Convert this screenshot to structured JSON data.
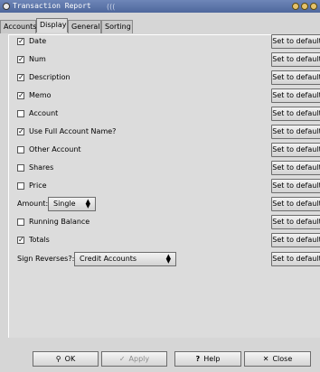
{
  "window": {
    "title": "Transaction Report",
    "title_grip": "((("
  },
  "tabs": [
    {
      "label": "Accounts",
      "active": false
    },
    {
      "label": "Display",
      "active": true
    },
    {
      "label": "General",
      "active": false
    },
    {
      "label": "Sorting",
      "active": false
    }
  ],
  "options": [
    {
      "label": "Date",
      "checked": true,
      "check_glyph": "✓"
    },
    {
      "label": "Num",
      "checked": true,
      "check_glyph": "✓"
    },
    {
      "label": "Description",
      "checked": true,
      "check_glyph": "✓"
    },
    {
      "label": "Memo",
      "checked": true,
      "check_glyph": "✓"
    },
    {
      "label": "Account",
      "checked": false,
      "check_glyph": ""
    },
    {
      "label": "Use Full Account Name?",
      "checked": true,
      "check_glyph": "✓"
    },
    {
      "label": "Other Account",
      "checked": false,
      "check_glyph": ""
    },
    {
      "label": "Shares",
      "checked": false,
      "check_glyph": ""
    },
    {
      "label": "Price",
      "checked": false,
      "check_glyph": ""
    }
  ],
  "amount": {
    "label": "Amount:",
    "value": "Single"
  },
  "options2": [
    {
      "label": "Running Balance",
      "checked": false,
      "check_glyph": ""
    },
    {
      "label": "Totals",
      "checked": true,
      "check_glyph": "✓"
    }
  ],
  "sign_reverses": {
    "label": "Sign Reverses?:",
    "value": "Credit Accounts"
  },
  "set_default_label": "Set to default",
  "buttons": {
    "ok": "OK",
    "apply": "Apply",
    "help": "Help",
    "close": "Close"
  },
  "colors": {
    "titlebar": "#5a73a8",
    "background": "#d6d6d6",
    "disabled_text": "#8c8c8c"
  }
}
